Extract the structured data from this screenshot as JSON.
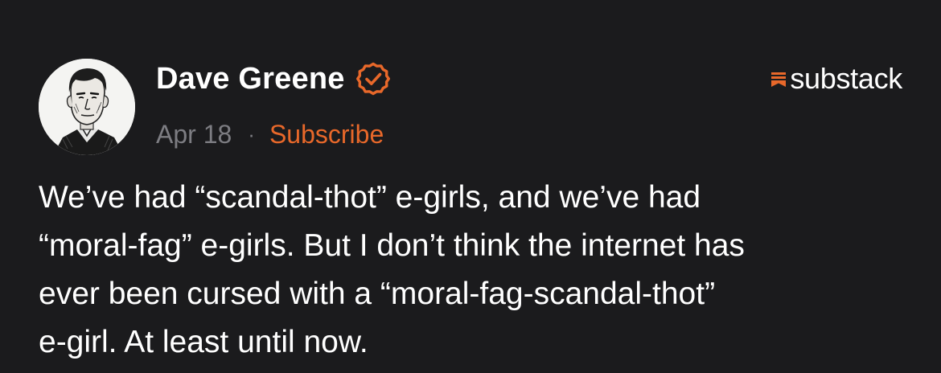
{
  "post": {
    "author": {
      "name": "Dave Greene",
      "avatar_icon": "portrait-sketch-avatar",
      "verified_icon": "verified-check-badge-icon"
    },
    "date": "Apr 18",
    "separator": "·",
    "subscribe_label": "Subscribe",
    "body_lines": [
      "We’ve had “scandal-thot” e-girls, and we’ve had",
      "“moral-fag” e-girls. But I don’t think the internet has",
      "ever been cursed with a “moral-fag-scandal-thot”",
      "e-girl. At least until now."
    ]
  },
  "brand": {
    "label": "substack",
    "icon": "substack-logo-icon"
  },
  "colors": {
    "background": "#1b1b1d",
    "accent": "#e8682a",
    "text_primary": "#ffffff",
    "text_muted": "#7d7d82"
  }
}
